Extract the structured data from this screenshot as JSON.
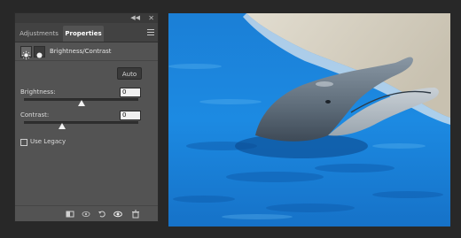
{
  "panel": {
    "tabs": [
      {
        "label": "Adjustments",
        "active": false
      },
      {
        "label": "Properties",
        "active": true
      }
    ],
    "adjustment_title": "Brightness/Contrast",
    "auto_label": "Auto",
    "brightness": {
      "label": "Brightness:",
      "value": "0",
      "slider_value": 0,
      "slider_range": [
        -150,
        150
      ]
    },
    "contrast": {
      "label": "Contrast:",
      "value": "0",
      "slider_value": 0,
      "slider_range": [
        -50,
        100
      ]
    },
    "use_legacy": {
      "label": "Use Legacy",
      "checked": false
    },
    "topbar_icons": [
      "collapse-icon",
      "close-icon"
    ],
    "footer_icons": [
      "clip-to-layer-icon",
      "view-previous-state-icon",
      "reset-icon",
      "visibility-icon",
      "trash-icon"
    ]
  },
  "colors": {
    "panel_bg": "#535353",
    "app_bg": "#282828",
    "water": "#1a87e0",
    "dolphin": "#6f7f8d"
  },
  "image": {
    "subject": "dolphin"
  }
}
